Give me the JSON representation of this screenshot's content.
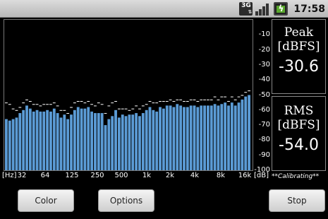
{
  "status_bar": {
    "network_label": "3G",
    "clock": "17:58",
    "icons": [
      "3g-data-icon",
      "signal-strength-icon",
      "battery-charging-icon"
    ]
  },
  "chart_data": {
    "type": "bar",
    "xlabel": "[Hz]",
    "ylabel": "[dB]",
    "ylim": [
      -100,
      0
    ],
    "y_ticks": [
      "-10",
      "-20",
      "-30",
      "-40",
      "-50",
      "-60",
      "-70",
      "-80",
      "-90",
      "-100"
    ],
    "x_ticks": [
      "32",
      "64",
      "125",
      "250",
      "500",
      "1k",
      "2k",
      "4k",
      "8k",
      "16k"
    ],
    "bar_color": "#5b9bd5",
    "peak_marker_color": "#ffffff",
    "values": [
      -66,
      -67,
      -66,
      -65,
      -62,
      -60,
      -57,
      -59,
      -61,
      -60,
      -61,
      -61,
      -60,
      -61,
      -59,
      -62,
      -65,
      -63,
      -66,
      -63,
      -60,
      -58,
      -59,
      -59,
      -58,
      -61,
      -62,
      -62,
      -62,
      -70,
      -66,
      -64,
      -60,
      -65,
      -63,
      -64,
      -63,
      -63,
      -62,
      -64,
      -62,
      -60,
      -58,
      -60,
      -61,
      -58,
      -59,
      -57,
      -57,
      -58,
      -56,
      -57,
      -58,
      -58,
      -57,
      -57,
      -58,
      -57,
      -57,
      -57,
      -57,
      -56,
      -57,
      -56,
      -55,
      -57,
      -55,
      -57,
      -55,
      -53,
      -51,
      -50
    ],
    "peaks": [
      -55,
      -56,
      -59,
      -60,
      -58,
      -55,
      -53,
      -54,
      -56,
      -56,
      -57,
      -56,
      -56,
      -56,
      -55,
      -57,
      -60,
      -60,
      -62,
      -58,
      -55,
      -54,
      -54,
      -55,
      -54,
      -56,
      -57,
      -55,
      -56,
      -62,
      -57,
      -55,
      -54,
      -59,
      -59,
      -59,
      -60,
      -59,
      -57,
      -59,
      -57,
      -56,
      -54,
      -55,
      -55,
      -54,
      -54,
      -54,
      -53,
      -54,
      -53,
      -53,
      -54,
      -54,
      -53,
      -53,
      -54,
      -53,
      -53,
      -53,
      -53,
      -51,
      -53,
      -51,
      -51,
      -54,
      -51,
      -53,
      -51,
      -50,
      -48,
      -47
    ]
  },
  "peak": {
    "label": "Peak",
    "unit": "[dBFS]",
    "value": "-30.6"
  },
  "rms": {
    "label": "RMS",
    "unit": "[dBFS]",
    "value": "-54.0"
  },
  "calibrating_text": "**Calibrating**",
  "buttons": {
    "color": "Color",
    "options": "Options",
    "stop": "Stop"
  }
}
